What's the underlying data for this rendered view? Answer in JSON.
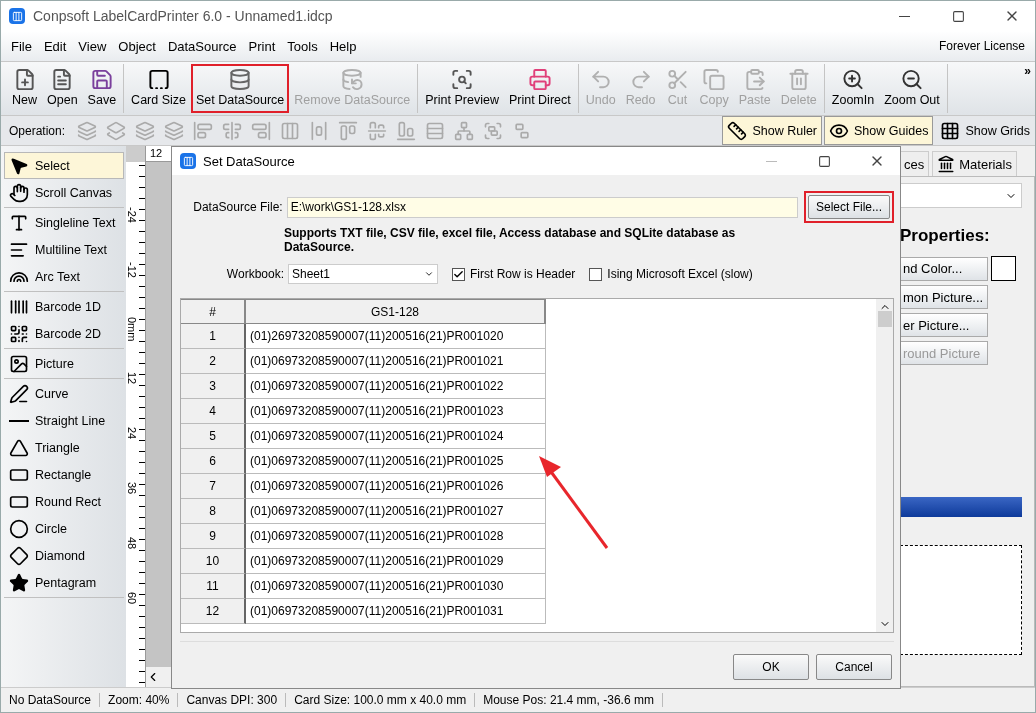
{
  "window": {
    "title": "Conpsoft LabelCardPrinter 6.0 - Unnamed1.idcp"
  },
  "menu": [
    "File",
    "Edit",
    "View",
    "Object",
    "DataSource",
    "Print",
    "Tools",
    "Help"
  ],
  "license": "Forever License",
  "toolbar": [
    {
      "items": [
        {
          "label": "New",
          "disabled": false,
          "highlighted": false
        },
        {
          "label": "Open",
          "disabled": false,
          "highlighted": false
        },
        {
          "label": "Save",
          "disabled": false,
          "highlighted": false
        }
      ]
    },
    {
      "items": [
        {
          "label": "Card Size",
          "disabled": false,
          "highlighted": false
        },
        {
          "label": "Set DataSource",
          "disabled": false,
          "highlighted": true
        },
        {
          "label": "Remove DataSource",
          "disabled": true,
          "highlighted": false
        }
      ]
    },
    {
      "items": [
        {
          "label": "Print Preview",
          "disabled": false,
          "highlighted": false
        },
        {
          "label": "Print Direct",
          "disabled": false,
          "highlighted": false
        }
      ]
    },
    {
      "items": [
        {
          "label": "Undo",
          "disabled": true,
          "highlighted": false
        },
        {
          "label": "Redo",
          "disabled": true,
          "highlighted": false
        },
        {
          "label": "Cut",
          "disabled": true,
          "highlighted": false
        },
        {
          "label": "Copy",
          "disabled": true,
          "highlighted": false
        },
        {
          "label": "Paste",
          "disabled": true,
          "highlighted": false
        },
        {
          "label": "Delete",
          "disabled": true,
          "highlighted": false
        }
      ]
    },
    {
      "items": [
        {
          "label": "ZoomIn",
          "disabled": false,
          "highlighted": false
        },
        {
          "label": "Zoom Out",
          "disabled": false,
          "highlighted": false
        }
      ]
    }
  ],
  "toolbar_overflow": "»",
  "operation": {
    "label": "Operation:",
    "toggles": [
      {
        "label": "Show Ruler",
        "selected": true
      },
      {
        "label": "Show Guides",
        "selected": true
      },
      {
        "label": "Show Grids",
        "selected": false
      }
    ]
  },
  "tools": [
    {
      "items": [
        {
          "label": "Select",
          "selected": true
        },
        {
          "label": "Scroll Canvas",
          "selected": false
        }
      ]
    },
    {
      "items": [
        {
          "label": "Singleline Text",
          "selected": false
        },
        {
          "label": "Multiline Text",
          "selected": false
        },
        {
          "label": "Arc Text",
          "selected": false
        }
      ]
    },
    {
      "items": [
        {
          "label": "Barcode 1D",
          "selected": false
        },
        {
          "label": "Barcode 2D",
          "selected": false
        }
      ]
    },
    {
      "items": [
        {
          "label": "Picture",
          "selected": false
        }
      ]
    },
    {
      "items": [
        {
          "label": "Curve",
          "selected": false
        },
        {
          "label": "Straight Line",
          "selected": false
        },
        {
          "label": "Triangle",
          "selected": false
        },
        {
          "label": "Rectangle",
          "selected": false
        },
        {
          "label": "Round Rect",
          "selected": false
        },
        {
          "label": "Circle",
          "selected": false
        },
        {
          "label": "Diamond",
          "selected": false
        },
        {
          "label": "Pentagram",
          "selected": false
        }
      ]
    }
  ],
  "ruler": {
    "top_label": "12",
    "side_labels": [
      "-24",
      "-12",
      "0mm",
      "12",
      "24",
      "36",
      "48",
      "60"
    ]
  },
  "right_panel": {
    "tabs": [
      {
        "label": "ces",
        "selected": false
      },
      {
        "label": "Materials",
        "selected": false
      }
    ],
    "heading": "Properties:",
    "buttons": [
      {
        "label": "nd Color...",
        "disabled": false
      },
      {
        "label": "mon Picture...",
        "disabled": false
      },
      {
        "label": "er Picture...",
        "disabled": false
      },
      {
        "label": "round Picture",
        "disabled": true
      }
    ]
  },
  "dialog": {
    "title": "Set DataSource",
    "file_label": "DataSource File:",
    "file_value": "E:\\work\\GS1-128.xlsx",
    "select_button": {
      "label": "Select File...",
      "highlighted": true
    },
    "note": "Supports TXT file, CSV file, excel file, Access database and SQLite database as DataSource.",
    "workbook_label": "Workbook:",
    "workbook_value": "Sheet1",
    "options": [
      {
        "label": "First Row is Header",
        "checked": true
      },
      {
        "label": "Ising Microsoft Excel (slow)",
        "checked": false
      }
    ],
    "table": {
      "columns": [
        "#",
        "GS1-128"
      ],
      "rows": [
        [
          "1",
          "(01)26973208590007(11)200516(21)PR001020"
        ],
        [
          "2",
          "(01)06973208590007(11)200516(21)PR001021"
        ],
        [
          "3",
          "(01)06973208590007(11)200516(21)PR001022"
        ],
        [
          "4",
          "(01)06973208590007(11)200516(21)PR001023"
        ],
        [
          "5",
          "(01)06973208590007(11)200516(21)PR001024"
        ],
        [
          "6",
          "(01)06973208590007(11)200516(21)PR001025"
        ],
        [
          "7",
          "(01)06973208590007(11)200516(21)PR001026"
        ],
        [
          "8",
          "(01)06973208590007(11)200516(21)PR001027"
        ],
        [
          "9",
          "(01)06973208590007(11)200516(21)PR001028"
        ],
        [
          "10",
          "(01)06973208590007(11)200516(21)PR001029"
        ],
        [
          "11",
          "(01)06973208590007(11)200516(21)PR001030"
        ],
        [
          "12",
          "(01)06973208590007(11)200516(21)PR001031"
        ]
      ]
    },
    "buttons": [
      "OK",
      "Cancel"
    ]
  },
  "status_bar": [
    "No DataSource",
    "Zoom: 40%",
    "Canvas DPI: 300",
    "Card Size: 100.0 mm x 40.0 mm",
    "Mouse Pos: 21.4 mm, -36.6 mm"
  ]
}
